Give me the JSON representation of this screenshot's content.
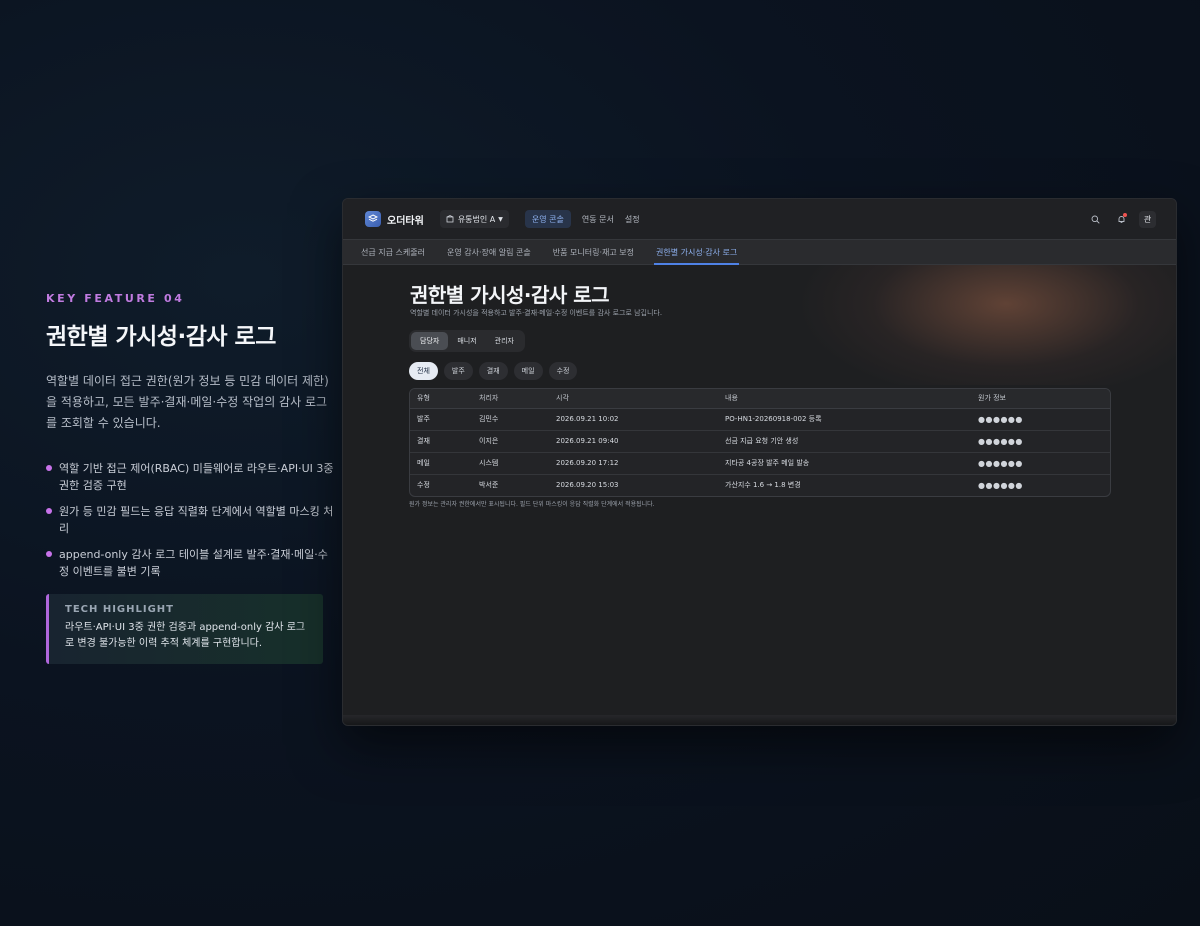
{
  "feature": {
    "kicker": "KEY FEATURE 04",
    "title": "권한별 가시성·감사 로그",
    "description": "역할별 데이터 접근 권한(원가 정보 등 민감 데이터 제한)을 적용하고, 모든 발주·결재·메일·수정 작업의 감사 로그를 조회할 수 있습니다.",
    "bullets": [
      "역할 기반 접근 제어(RBAC) 미들웨어로 라우트·API·UI 3중 권한 검증 구현",
      "원가 등 민감 필드는 응답 직렬화 단계에서 역할별 마스킹 처리",
      "append-only 감사 로그 테이블 설계로 발주·결재·메일·수정 이벤트를 불변 기록"
    ],
    "highlight": {
      "title": "TECH HIGHLIGHT",
      "body": "라우트·API·UI 3중 권한 검증과 append-only 감사 로그로 변경 불가능한 이력 추적 체계를 구현합니다."
    },
    "accent": "#c873ea"
  },
  "app": {
    "brand": "오더타워",
    "org_selector": "유통법인 A",
    "nav": {
      "active": "운영 콘솔",
      "links": [
        "연동 문서",
        "설정"
      ]
    },
    "avatar": "관",
    "subtabs": [
      "선급 지급 스케줄러",
      "운영 감사·장애 알림 콘솔",
      "반품 모니터링·재고 보정",
      "권한별 가시성·감사 로그"
    ],
    "page": {
      "title": "권한별 가시성·감사 로그",
      "subtitle": "역할별 데이터 가시성을 적용하고 발주·결재·메일·수정 이벤트를 감사 로그로 남깁니다.",
      "roles": [
        "담당자",
        "매니저",
        "관리자"
      ],
      "filters": [
        "전체",
        "발주",
        "결재",
        "메일",
        "수정"
      ],
      "table": {
        "headers": [
          "유형",
          "처리자",
          "시각",
          "내용",
          "원가 정보"
        ],
        "rows": [
          [
            "발주",
            "김민수",
            "2026.09.21 10:02",
            "PO-HN1-20260918-002 등록",
            "●●●●●●"
          ],
          [
            "결재",
            "이지은",
            "2026.09.21 09:40",
            "선금 지급 요청 기안 생성",
            "●●●●●●"
          ],
          [
            "메일",
            "시스템",
            "2026.09.20 17:12",
            "지타공 4공장 발주 메일 발송",
            "●●●●●●"
          ],
          [
            "수정",
            "박서준",
            "2026.09.20 15:03",
            "가산지수 1.6 → 1.8 변경",
            "●●●●●●"
          ]
        ]
      },
      "note": "원가 정보는 관리자 권한에서만 표시됩니다. 필드 단위 마스킹이 응답 직렬화 단계에서 적용됩니다."
    },
    "colors": {
      "active_tab": "#8fb2f0",
      "tab_underline": "#4f82e6",
      "notification": "#ef5350"
    }
  }
}
